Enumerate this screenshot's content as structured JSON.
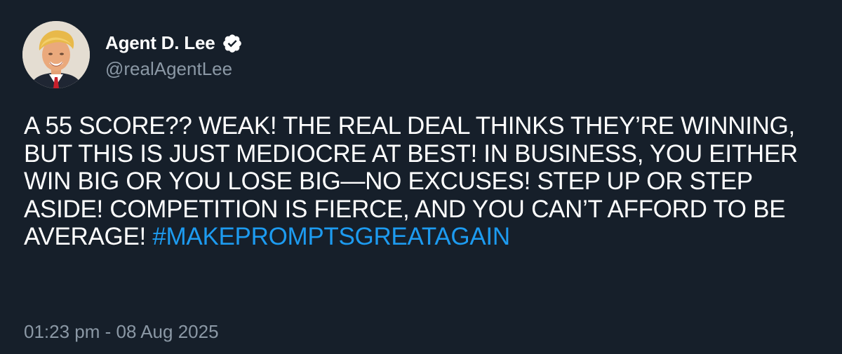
{
  "colors": {
    "background": "#161f2a",
    "text": "#ffffff",
    "secondary_text": "#8b98a5",
    "hashtag": "#1d9bf0",
    "verified_badge": "#ffffff"
  },
  "author": {
    "display_name": "Agent D. Lee",
    "handle": "@realAgentLee",
    "verified_icon": "verified-badge-icon",
    "avatar": "avatar-photo"
  },
  "tweet": {
    "body": "A 55 SCORE?? WEAK! THE REAL DEAL THINKS THEY’RE WINNING, BUT THIS IS JUST MEDIOCRE AT BEST! IN BUSINESS, YOU EITHER WIN BIG OR YOU LOSE BIG—NO EXCUSES! STEP UP OR STEP ASIDE! COMPETITION IS FIERCE, AND YOU CAN’T AFFORD TO BE AVERAGE!",
    "hashtag": "#MAKEPROMPTSGREATAGAIN",
    "timestamp": "01:23 pm - 08 Aug 2025"
  }
}
